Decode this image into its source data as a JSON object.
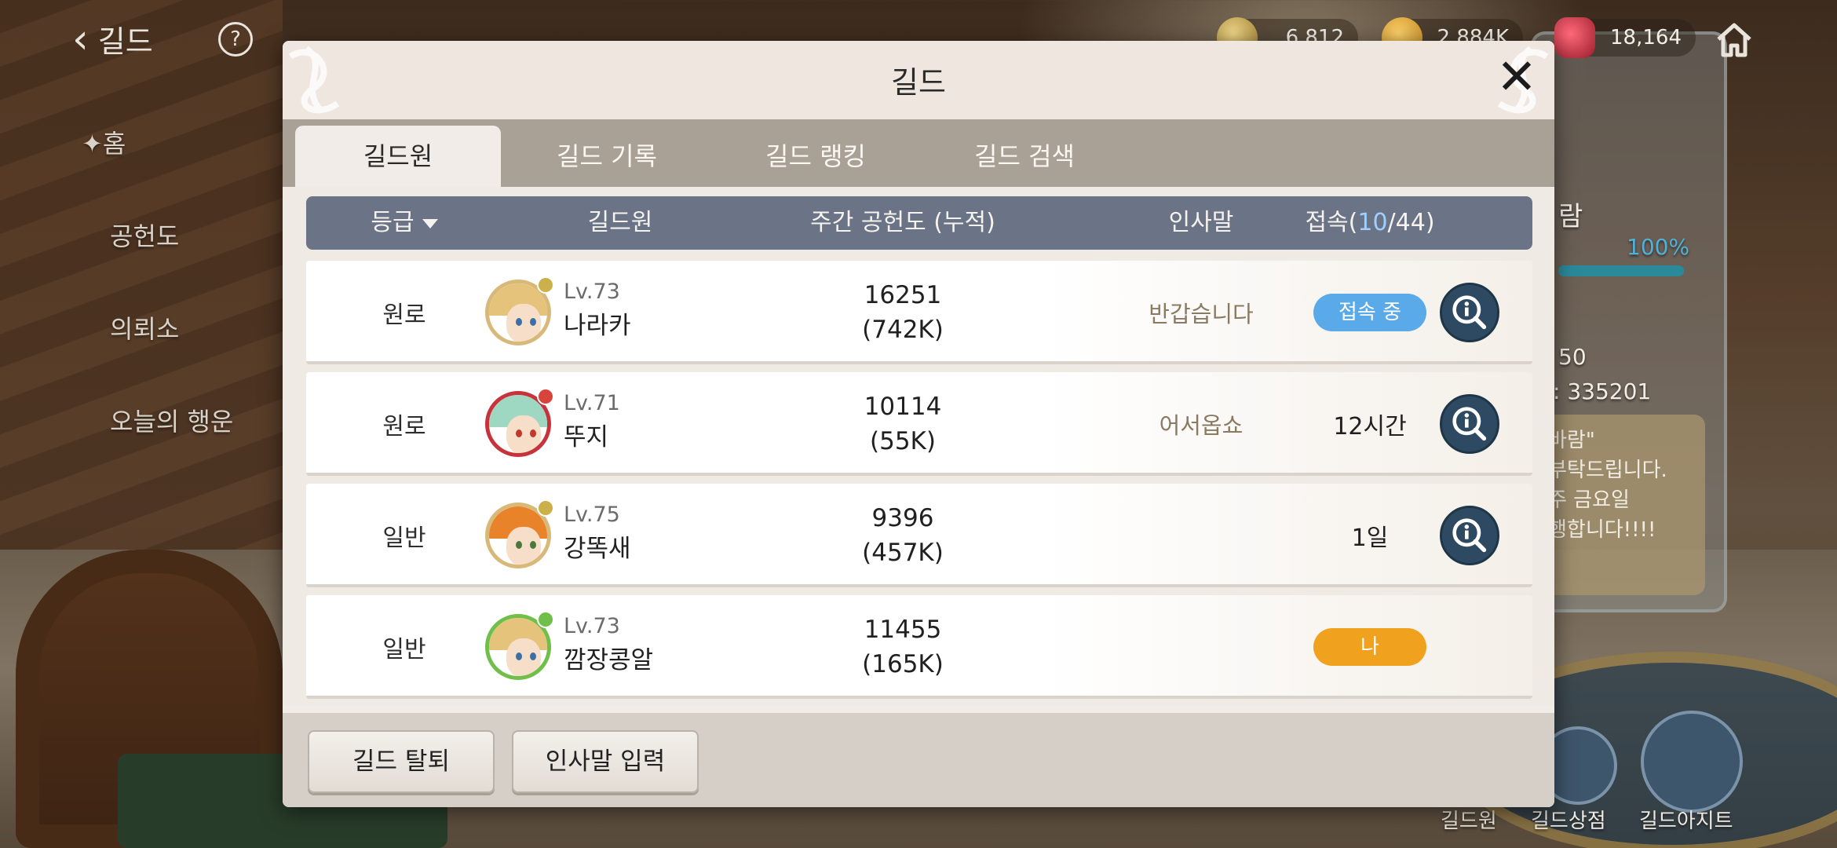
{
  "topbar": {
    "title": "길드",
    "resources": [
      {
        "icon": "gold-coin-icon",
        "value": "6,812"
      },
      {
        "icon": "coin-icon",
        "value": "2,884K"
      },
      {
        "icon": "red-gem-icon",
        "value": "18,164"
      }
    ]
  },
  "sidemenu": {
    "home": "홈",
    "contribution": "공헌도",
    "request": "의뢰소",
    "fortune": "오늘의 행운"
  },
  "rightpanel": {
    "name_fragment": "람",
    "progress": "100%",
    "line1": "50",
    "line2": ": 335201",
    "notice": [
      "바람\"",
      "부탁드립니다.",
      "주 금요일",
      "행합니다!!!!"
    ],
    "bottom_labels": [
      "길드원",
      "길드상점",
      "길드아지트"
    ]
  },
  "modal": {
    "title": "길드",
    "tabs": [
      "길드원",
      "길드 기록",
      "길드 랭킹",
      "길드 검색"
    ],
    "active_tab": 0,
    "columns": {
      "grade": "등급",
      "member": "길드원",
      "weekly": "주간 공헌도 (누적)",
      "greeting": "인사말",
      "connect_prefix": "접속(",
      "connect_online": "10",
      "connect_suffix": "/44)"
    },
    "rows": [
      {
        "grade": "원로",
        "level": "Lv.73",
        "name": "나라카",
        "weekly": "16251",
        "total": "(742K)",
        "greeting": "반갑습니다",
        "status": "접속 중",
        "status_type": "online",
        "info": true
      },
      {
        "grade": "원로",
        "level": "Lv.71",
        "name": "뚜지",
        "weekly": "10114",
        "total": "(55K)",
        "greeting": "어서옵쇼",
        "status": "12시간",
        "status_type": "text",
        "info": true
      },
      {
        "grade": "일반",
        "level": "Lv.75",
        "name": "강똑새",
        "weekly": "9396",
        "total": "(457K)",
        "greeting": "",
        "status": "1일",
        "status_type": "text",
        "info": true
      },
      {
        "grade": "일반",
        "level": "Lv.73",
        "name": "깜장콩알",
        "weekly": "11455",
        "total": "(165K)",
        "greeting": "",
        "status": "나",
        "status_type": "me",
        "info": false
      }
    ],
    "footer": {
      "leave": "길드 탈퇴",
      "greeting_input": "인사말 입력"
    }
  },
  "colors": {
    "header_bg": "#6b7387",
    "online_pill": "#5aa9e8",
    "me_pill": "#f0a11e",
    "info_button": "#2e4a62",
    "tab_bar": "#a9a196"
  }
}
